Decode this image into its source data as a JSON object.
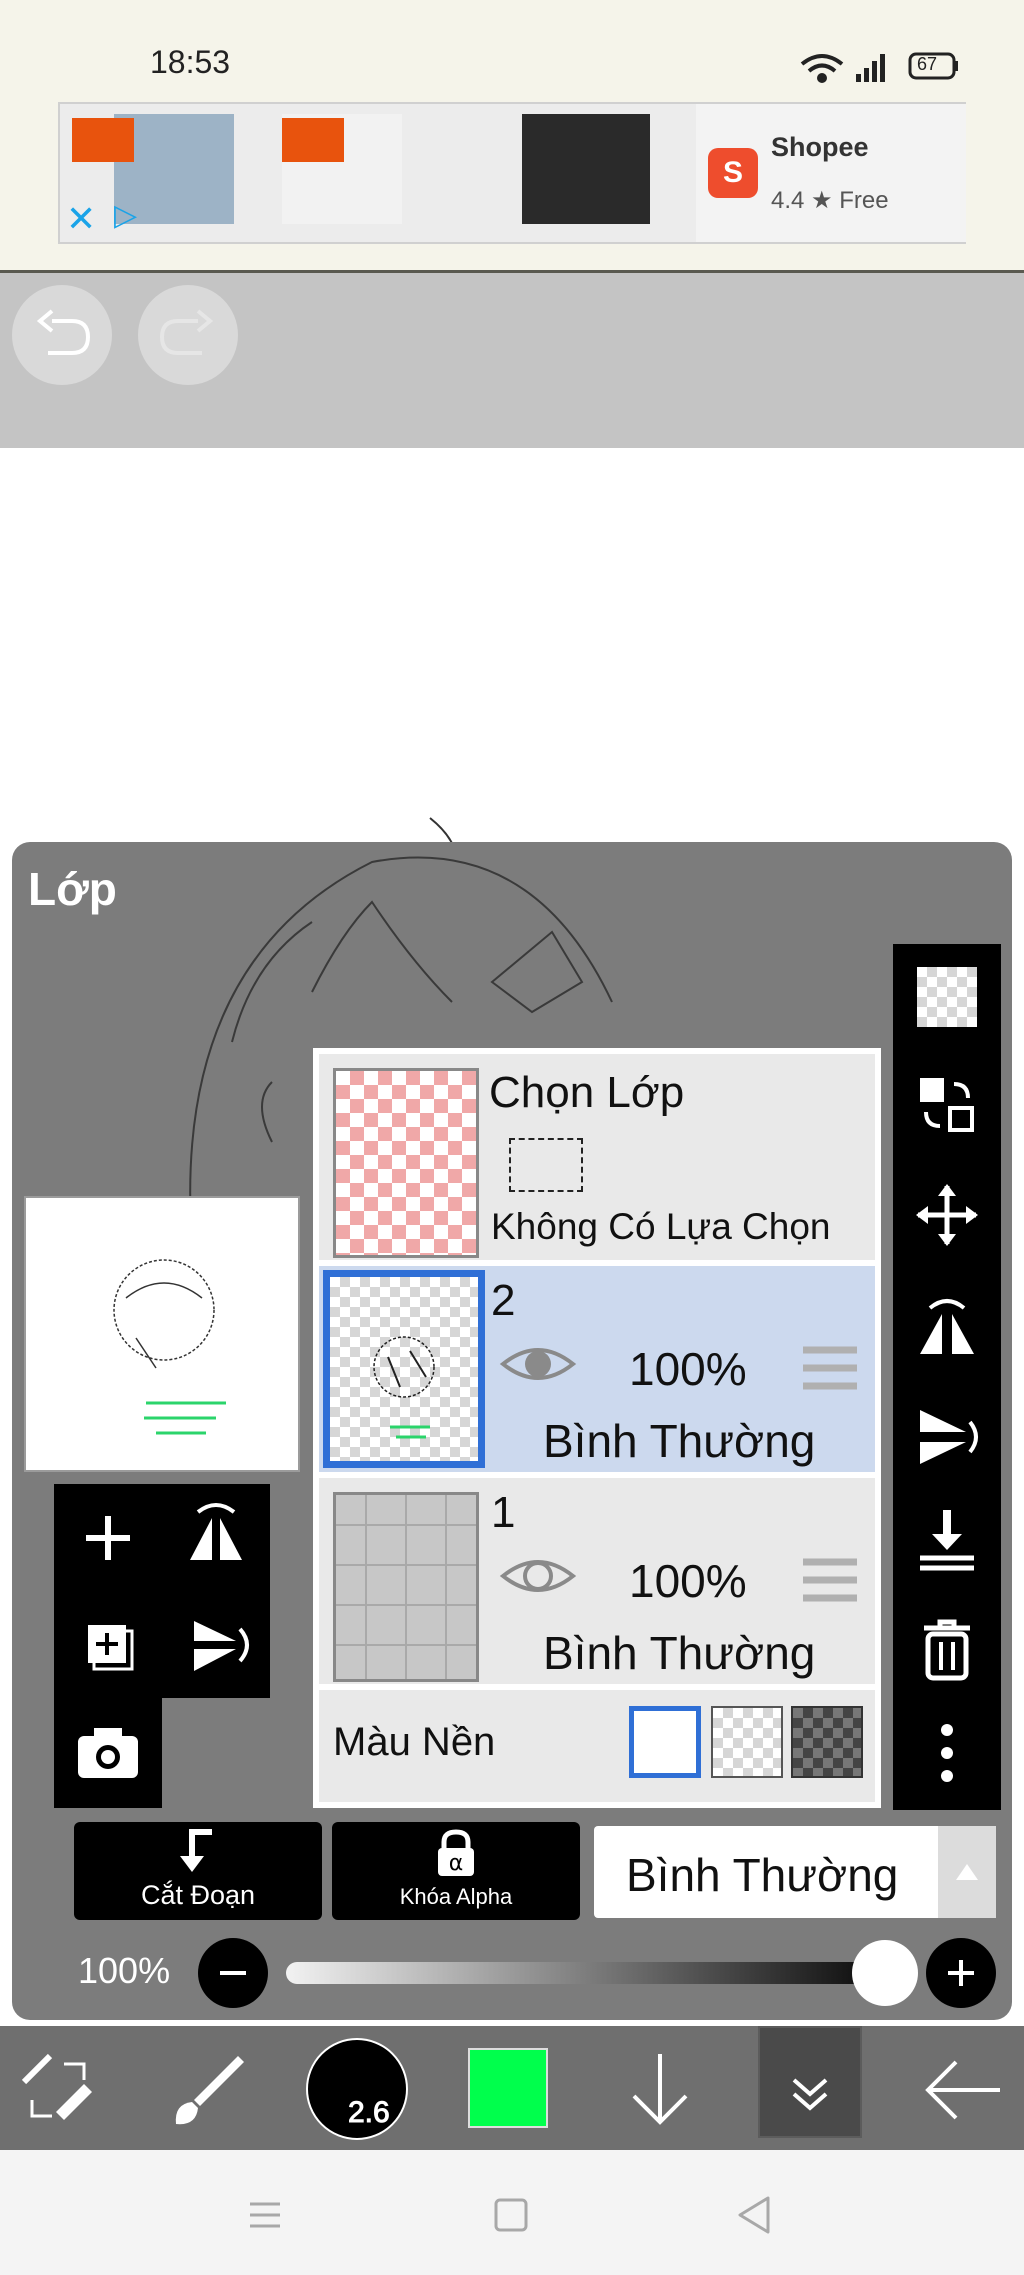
{
  "status_bar": {
    "time": "18:53",
    "battery": "67"
  },
  "ad": {
    "advertiser": "Shopee",
    "rating": "4.4 ★ Free"
  },
  "panel": {
    "title": "Lớp"
  },
  "selection_layer": {
    "title": "Chọn Lớp",
    "subtitle": "Không Có Lựa Chọn"
  },
  "layers": [
    {
      "number": "2",
      "opacity": "100%",
      "blend": "Bình Thường",
      "selected": true
    },
    {
      "number": "1",
      "opacity": "100%",
      "blend": "Bình Thường",
      "selected": false
    }
  ],
  "background_row": {
    "label": "Màu Nền"
  },
  "bottom_buttons": {
    "clip_label": "Cắt Đoạn",
    "alpha_lock_label": "Khóa Alpha",
    "blend_mode": "Bình Thường"
  },
  "opacity_slider": {
    "label": "100%",
    "value": 1.0
  },
  "brush": {
    "size": "2.6"
  },
  "colors": {
    "current": "#00ff4c",
    "selected_layer_bg": "#ccd9ee",
    "selected_border": "#2f6fd6"
  }
}
